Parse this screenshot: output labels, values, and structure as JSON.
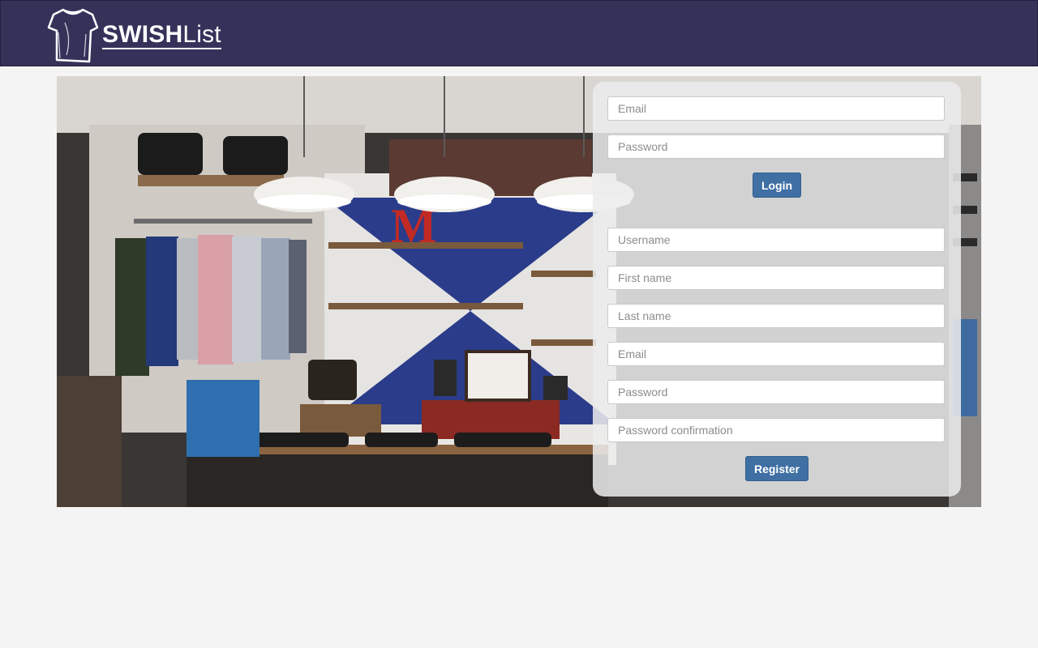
{
  "brand": {
    "name_bold": "SWISH",
    "name_light": "List"
  },
  "colors": {
    "navbar": "#35325a",
    "button": "#3f6fa3",
    "background": "#f4f4f4"
  },
  "hero_image": {
    "description_icon": "clothing-store-photo"
  },
  "login": {
    "email_placeholder": "Email",
    "password_placeholder": "Password",
    "submit_label": "Login"
  },
  "register": {
    "username_placeholder": "Username",
    "first_name_placeholder": "First name",
    "last_name_placeholder": "Last name",
    "email_placeholder": "Email",
    "password_placeholder": "Password",
    "password_confirmation_placeholder": "Password confirmation",
    "submit_label": "Register"
  }
}
